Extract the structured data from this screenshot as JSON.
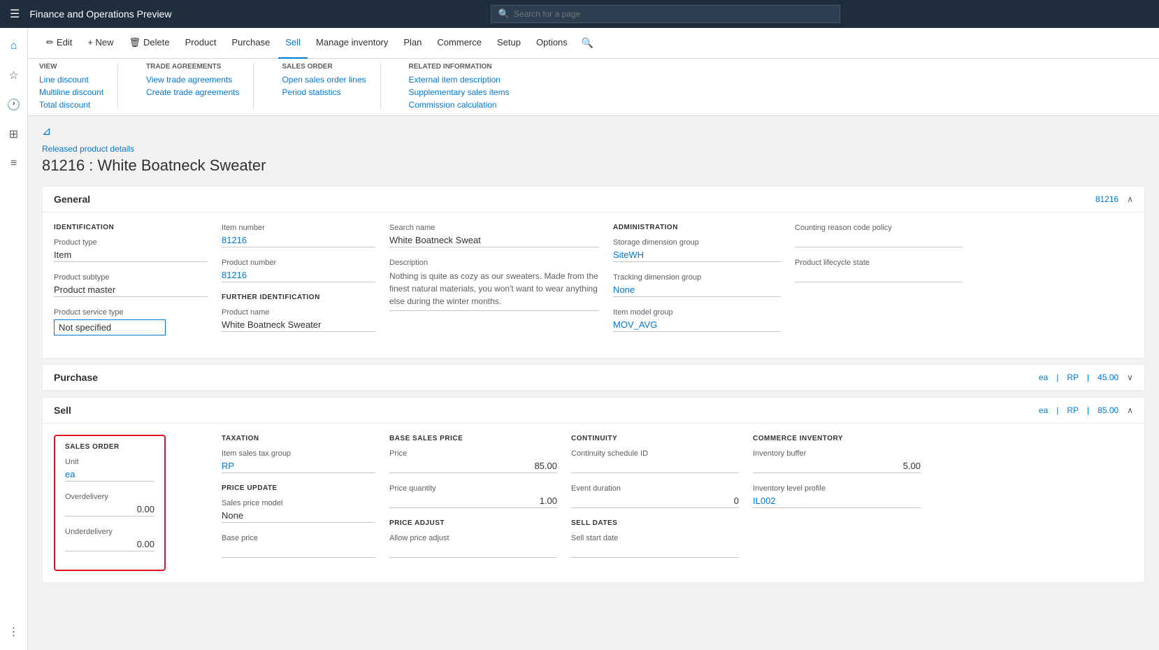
{
  "topBar": {
    "title": "Finance and Operations Preview",
    "searchPlaceholder": "Search for a page"
  },
  "toolbar": {
    "editLabel": "Edit",
    "newLabel": "+ New",
    "deleteLabel": "Delete",
    "productLabel": "Product",
    "purchaseLabel": "Purchase",
    "sellLabel": "Sell",
    "manageInventoryLabel": "Manage inventory",
    "planLabel": "Plan",
    "commerceLabel": "Commerce",
    "setupLabel": "Setup",
    "optionsLabel": "Options"
  },
  "ribbon": {
    "groups": [
      {
        "title": "View",
        "links": [
          "Line discount",
          "Multiline discount",
          "Total discount"
        ]
      },
      {
        "title": "Trade agreements",
        "links": [
          "View trade agreements",
          "Create trade agreements"
        ]
      },
      {
        "title": "Sales order",
        "links": [
          "Open sales order lines",
          "Period statistics"
        ]
      },
      {
        "title": "Related information",
        "links": [
          "External item description",
          "Supplementary sales items",
          "Commission calculation"
        ]
      }
    ]
  },
  "breadcrumb": "Released product details",
  "pageTitle": "81216 : White Boatneck Sweater",
  "sections": {
    "general": {
      "title": "General",
      "collapseLabel": "81216",
      "identification": {
        "sectionLabel": "IDENTIFICATION",
        "fields": [
          {
            "label": "Product type",
            "value": "Item",
            "blue": false
          },
          {
            "label": "Product subtype",
            "value": "Product master",
            "blue": false
          },
          {
            "label": "Product service type",
            "value": "Not specified",
            "input": true
          }
        ]
      },
      "itemNumber": {
        "label": "Item number",
        "value": "81216",
        "blue": true
      },
      "productNumber": {
        "label": "Product number",
        "value": "81216",
        "blue": true
      },
      "furtherIdentification": {
        "sectionLabel": "FURTHER IDENTIFICATION",
        "productName": {
          "label": "Product name",
          "value": "White Boatneck Sweater"
        }
      },
      "searchName": {
        "label": "Search name",
        "value": "White Boatneck Sweat"
      },
      "description": {
        "label": "Description",
        "value": "Nothing is quite as cozy as our sweaters. Made from the finest natural materials, you won't want to wear anything else during the winter months."
      },
      "administration": {
        "sectionLabel": "ADMINISTRATION",
        "fields": [
          {
            "label": "Storage dimension group",
            "value": "SiteWH",
            "blue": true
          },
          {
            "label": "Tracking dimension group",
            "value": "None",
            "blue": true
          },
          {
            "label": "Item model group",
            "value": "MOV_AVG",
            "blue": true
          }
        ]
      },
      "countingReasonCodePolicy": {
        "label": "Counting reason code policy",
        "value": ""
      },
      "productLifecycleState": {
        "label": "Product lifecycle state",
        "value": ""
      }
    },
    "purchase": {
      "title": "Purchase",
      "rightLabels": [
        "ea",
        "RP",
        "45.00"
      ]
    },
    "sell": {
      "title": "Sell",
      "rightLabels": [
        "ea",
        "RP",
        "85.00"
      ],
      "salesOrder": {
        "sectionLabel": "SALES ORDER",
        "unitLabel": "Unit",
        "unitValue": "ea",
        "overdeliveryLabel": "Overdelivery",
        "overdeliveryValue": "0.00",
        "underdeliveryLabel": "Underdelivery",
        "underdeliveryValue": "0.00"
      },
      "taxation": {
        "sectionLabel": "TAXATION",
        "itemSalesTaxGroupLabel": "Item sales tax group",
        "itemSalesTaxGroupValue": "RP",
        "priceUpdateLabel": "PRICE UPDATE",
        "salesPriceModelLabel": "Sales price model",
        "salesPriceModelValue": "None",
        "basePriceLabel": "Base price"
      },
      "baseSalesPrice": {
        "sectionLabel": "BASE SALES PRICE",
        "priceLabel": "Price",
        "priceValue": "85.00",
        "priceQuantityLabel": "Price quantity",
        "priceQuantityValue": "1.00",
        "priceAdjustLabel": "PRICE ADJUST",
        "allowPriceAdjustLabel": "Allow price adjust"
      },
      "continuity": {
        "sectionLabel": "CONTINUITY",
        "continuityScheduleIDLabel": "Continuity schedule ID",
        "continuityScheduleIDValue": "",
        "eventDurationLabel": "Event duration",
        "eventDurationValue": "0",
        "sellDatesLabel": "SELL DATES",
        "sellStartDateLabel": "Sell start date"
      },
      "commerceInventory": {
        "sectionLabel": "COMMERCE INVENTORY",
        "inventoryBufferLabel": "Inventory buffer",
        "inventoryBufferValue": "5.00",
        "inventoryLevelProfileLabel": "Inventory level profile",
        "inventoryLevelProfileValue": "IL002"
      }
    }
  }
}
